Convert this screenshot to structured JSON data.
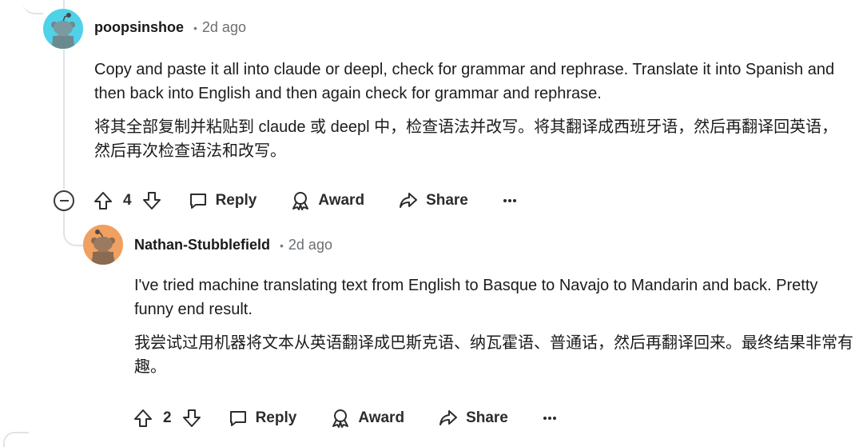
{
  "comments": [
    {
      "author": "poopsinshoe",
      "time": "2d ago",
      "text_en": "Copy and paste it all into claude or deepl, check for grammar and rephrase. Translate it into Spanish and then back into English and then again check for grammar and rephrase.",
      "text_zh": "将其全部复制并粘贴到 claude 或 deepl 中，检查语法并改写。将其翻译成西班牙语，然后再翻译回英语，然后再次检查语法和改写。",
      "votes": "4",
      "avatar_color": "#4fd1e8"
    },
    {
      "author": "Nathan-Stubblefield",
      "time": "2d ago",
      "text_en": "I've tried machine translating text from English to Basque to Navajo to Mandarin and back. Pretty funny end result.",
      "text_zh": "我尝试过用机器将文本从英语翻译成巴斯克语、纳瓦霍语、普通话，然后再翻译回来。最终结果非常有趣。",
      "votes": "2",
      "avatar_color": "#f0a060"
    }
  ],
  "actions": {
    "reply": "Reply",
    "award": "Award",
    "share": "Share"
  },
  "separator": "•"
}
